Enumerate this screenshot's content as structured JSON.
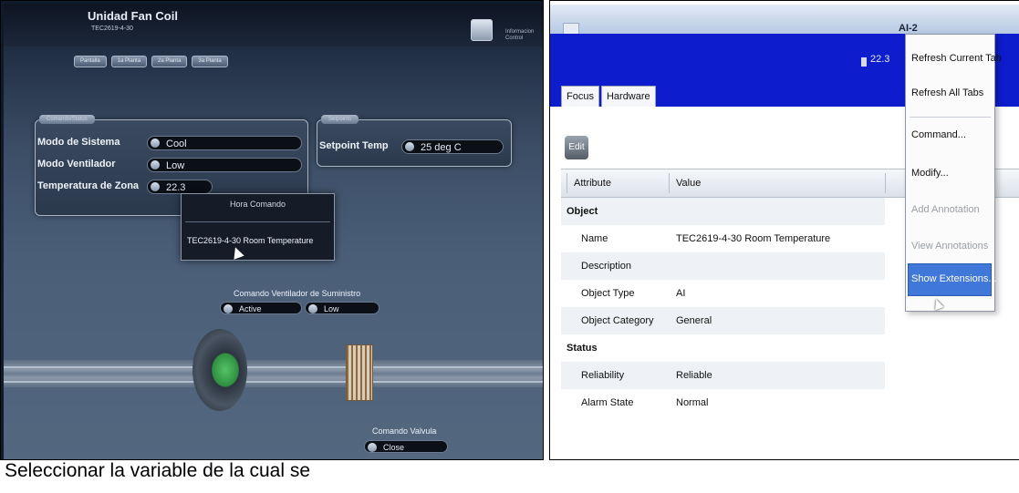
{
  "left_panel": {
    "header": {
      "title": "Unidad Fan Coil",
      "subtitle": "TEC2619-4-30",
      "side_text": "Informacion Control"
    },
    "tabs": [
      "Pantalla",
      "1a Planta",
      "2a Planta",
      "3a Planta"
    ],
    "status_card": {
      "title": "Comando/Status",
      "rows": [
        {
          "label": "Modo de Sistema",
          "value": "Cool"
        },
        {
          "label": "Modo Ventilador",
          "value": "Low"
        },
        {
          "label": "Temperatura de Zona",
          "value": "22.3"
        }
      ]
    },
    "setpoint_card": {
      "title": "Setpoints",
      "label": "Setpoint Temp",
      "value": "25 deg C"
    },
    "popup": {
      "header": "Hora Comando",
      "item": "TEC2619-4-30 Room Temperature"
    },
    "fan_command": {
      "label": "Comando Ventilador de Suministro",
      "value1": "Active",
      "value2": "Low"
    },
    "valve_command": {
      "label": "Comando Valvula",
      "value": "Close"
    }
  },
  "caption": "Seleccionar la variable de la cual se",
  "right_panel": {
    "title_fragment": "AI-2",
    "meter_value": "22.3",
    "tabs": [
      "Focus",
      "Hardware"
    ],
    "edit_button": "Edit",
    "columns": [
      "Attribute",
      "Value"
    ],
    "rows": [
      {
        "attribute": "Object",
        "value": "",
        "section": true
      },
      {
        "attribute": "Name",
        "value": "TEC2619-4-30 Room Temperature",
        "section": false
      },
      {
        "attribute": "Description",
        "value": "",
        "section": false
      },
      {
        "attribute": "Object Type",
        "value": "AI",
        "section": false
      },
      {
        "attribute": "Object Category",
        "value": "General",
        "section": false
      },
      {
        "attribute": "Status",
        "value": "",
        "section": true
      },
      {
        "attribute": "Reliability",
        "value": "Reliable",
        "section": false
      },
      {
        "attribute": "Alarm State",
        "value": "Normal",
        "section": false
      }
    ],
    "context_menu": [
      {
        "label": "Refresh Current Tab",
        "state": "enabled"
      },
      {
        "label": "Refresh All Tabs",
        "state": "enabled"
      },
      {
        "label": "Command...",
        "state": "enabled"
      },
      {
        "label": "Modify...",
        "state": "enabled"
      },
      {
        "label": "Add Annotation",
        "state": "disabled"
      },
      {
        "label": "View Annotations",
        "state": "disabled"
      },
      {
        "label": "Show Extensions...",
        "state": "selected"
      }
    ]
  },
  "colors": {
    "blue_bar": "#0d1ccc",
    "menu_highlight": "#3f78d8",
    "scada_bg": "#4a5e78"
  }
}
